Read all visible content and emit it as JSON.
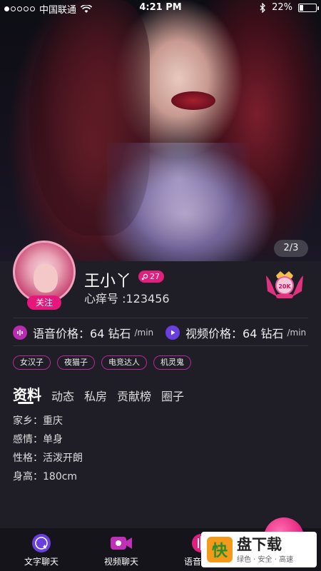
{
  "status_bar": {
    "carrier": "中国联通",
    "time": "4:21 PM",
    "battery": "22%",
    "battery_level": 0.22,
    "signal_bars": 1
  },
  "hero": {
    "photo_counter": "2/3"
  },
  "profile": {
    "follow_label": "关注",
    "name": "王小丫",
    "level": "27",
    "uid": "心痒号 :123456",
    "badge_text": "20K"
  },
  "prices": {
    "voice": {
      "label": "语音价格：",
      "value": "64 钻石",
      "unit": "/min"
    },
    "video": {
      "label": "视频价格：",
      "value": "64 钻石",
      "unit": "/min"
    }
  },
  "tags": [
    "女汉子",
    "夜猫子",
    "电竞达人",
    "机灵鬼"
  ],
  "tabs": {
    "items": [
      "资料",
      "动态",
      "私房",
      "贡献榜",
      "圈子"
    ],
    "active_index": 0
  },
  "info": [
    "家乡：重庆",
    "感情：单身",
    "性格：活泼开朗",
    "身高：180cm"
  ],
  "bottom_nav": {
    "text_chat": "文字聊天",
    "video_chat": "视频聊天",
    "voice_chat": "语音聊天"
  },
  "watermark": {
    "logo_char": "快",
    "title": "盘下载",
    "subtitle": "绿色 · 安全 · 高速"
  },
  "colors": {
    "accent_pink": "#e5177b",
    "accent_purple": "#6a3fe0",
    "tag_border": "#b52a9c",
    "panel_bg": "#1f1e26"
  }
}
